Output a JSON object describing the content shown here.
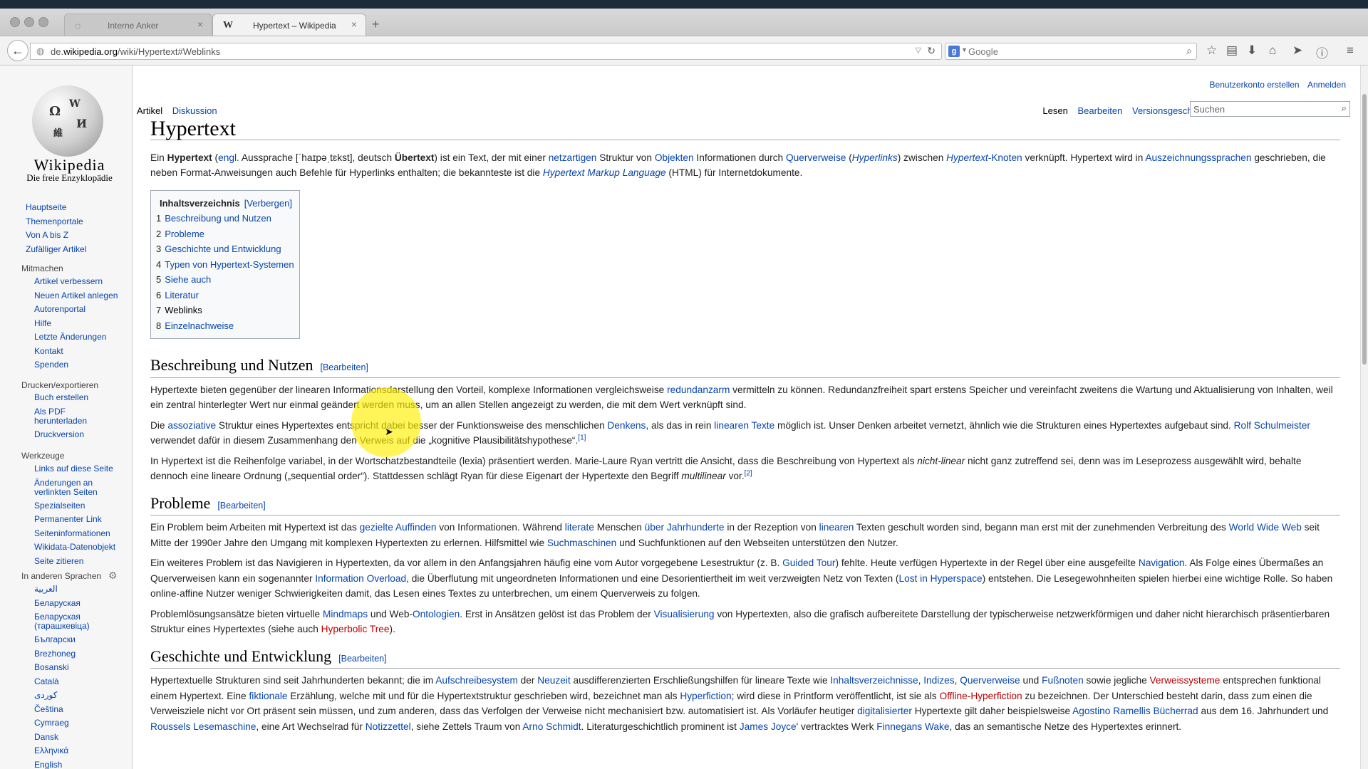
{
  "browser": {
    "tabs": [
      {
        "label": "Interne Anker",
        "active": false
      },
      {
        "label": "Hypertext – Wikipedia",
        "active": true
      }
    ],
    "url_prefix": "de.",
    "url_host": "wikipedia.org",
    "url_path": "/wiki/Hypertext#Weblinks",
    "search_placeholder": "Google"
  },
  "wiki": {
    "logo_title": "Wikipedia",
    "logo_subtitle": "Die freie Enzyklopädie",
    "top_links": [
      "Benutzerkonto erstellen",
      "Anmelden"
    ],
    "tabs_left": [
      "Artikel",
      "Diskussion"
    ],
    "tabs_right": [
      "Lesen",
      "Bearbeiten",
      "Versionsgeschichte"
    ],
    "search_placeholder": "Suchen",
    "sidebar": {
      "main": [
        "Hauptseite",
        "Themenportale",
        "Von A bis Z",
        "Zufälliger Artikel"
      ],
      "mitmachen_head": "Mitmachen",
      "mitmachen": [
        "Artikel verbessern",
        "Neuen Artikel anlegen",
        "Autorenportal",
        "Hilfe",
        "Letzte Änderungen",
        "Kontakt",
        "Spenden"
      ],
      "drucken_head": "Drucken/exportieren",
      "drucken": [
        "Buch erstellen",
        "Als PDF herunterladen",
        "Druckversion"
      ],
      "werkzeuge_head": "Werkzeuge",
      "werkzeuge": [
        "Links auf diese Seite",
        "Änderungen an verlinkten Seiten",
        "Spezialseiten",
        "Permanenter Link",
        "Seiteninformationen",
        "Wikidata-Datenobjekt",
        "Seite zitieren"
      ],
      "sprachen_head": "In anderen Sprachen",
      "sprachen": [
        "العربية",
        "Беларуская",
        "Беларуская (тарашкевіца)",
        "Български",
        "Brezhoneg",
        "Bosanski",
        "Català",
        "کوردی",
        "Čeština",
        "Cymraeg",
        "Dansk",
        "Ελληνικά",
        "English"
      ]
    },
    "article": {
      "title": "Hypertext",
      "edit_label": "[Bearbeiten]",
      "toc_title": "Inhaltsverzeichnis",
      "toc_hide": "[Verbergen]",
      "toc": [
        {
          "num": "1",
          "label": "Beschreibung und Nutzen"
        },
        {
          "num": "2",
          "label": "Probleme"
        },
        {
          "num": "3",
          "label": "Geschichte und Entwicklung"
        },
        {
          "num": "4",
          "label": "Typen von Hypertext-Systemen"
        },
        {
          "num": "5",
          "label": "Siehe auch"
        },
        {
          "num": "6",
          "label": "Literatur"
        },
        {
          "num": "7",
          "label": "Weblinks"
        },
        {
          "num": "8",
          "label": "Einzelnachweise"
        }
      ],
      "h_beschreibung": "Beschreibung und Nutzen",
      "h_probleme": "Probleme",
      "h_geschichte": "Geschichte und Entwicklung"
    }
  },
  "colors": {
    "link": "#0645ad",
    "redlink": "#ba0000",
    "highlight": "#fff000"
  }
}
